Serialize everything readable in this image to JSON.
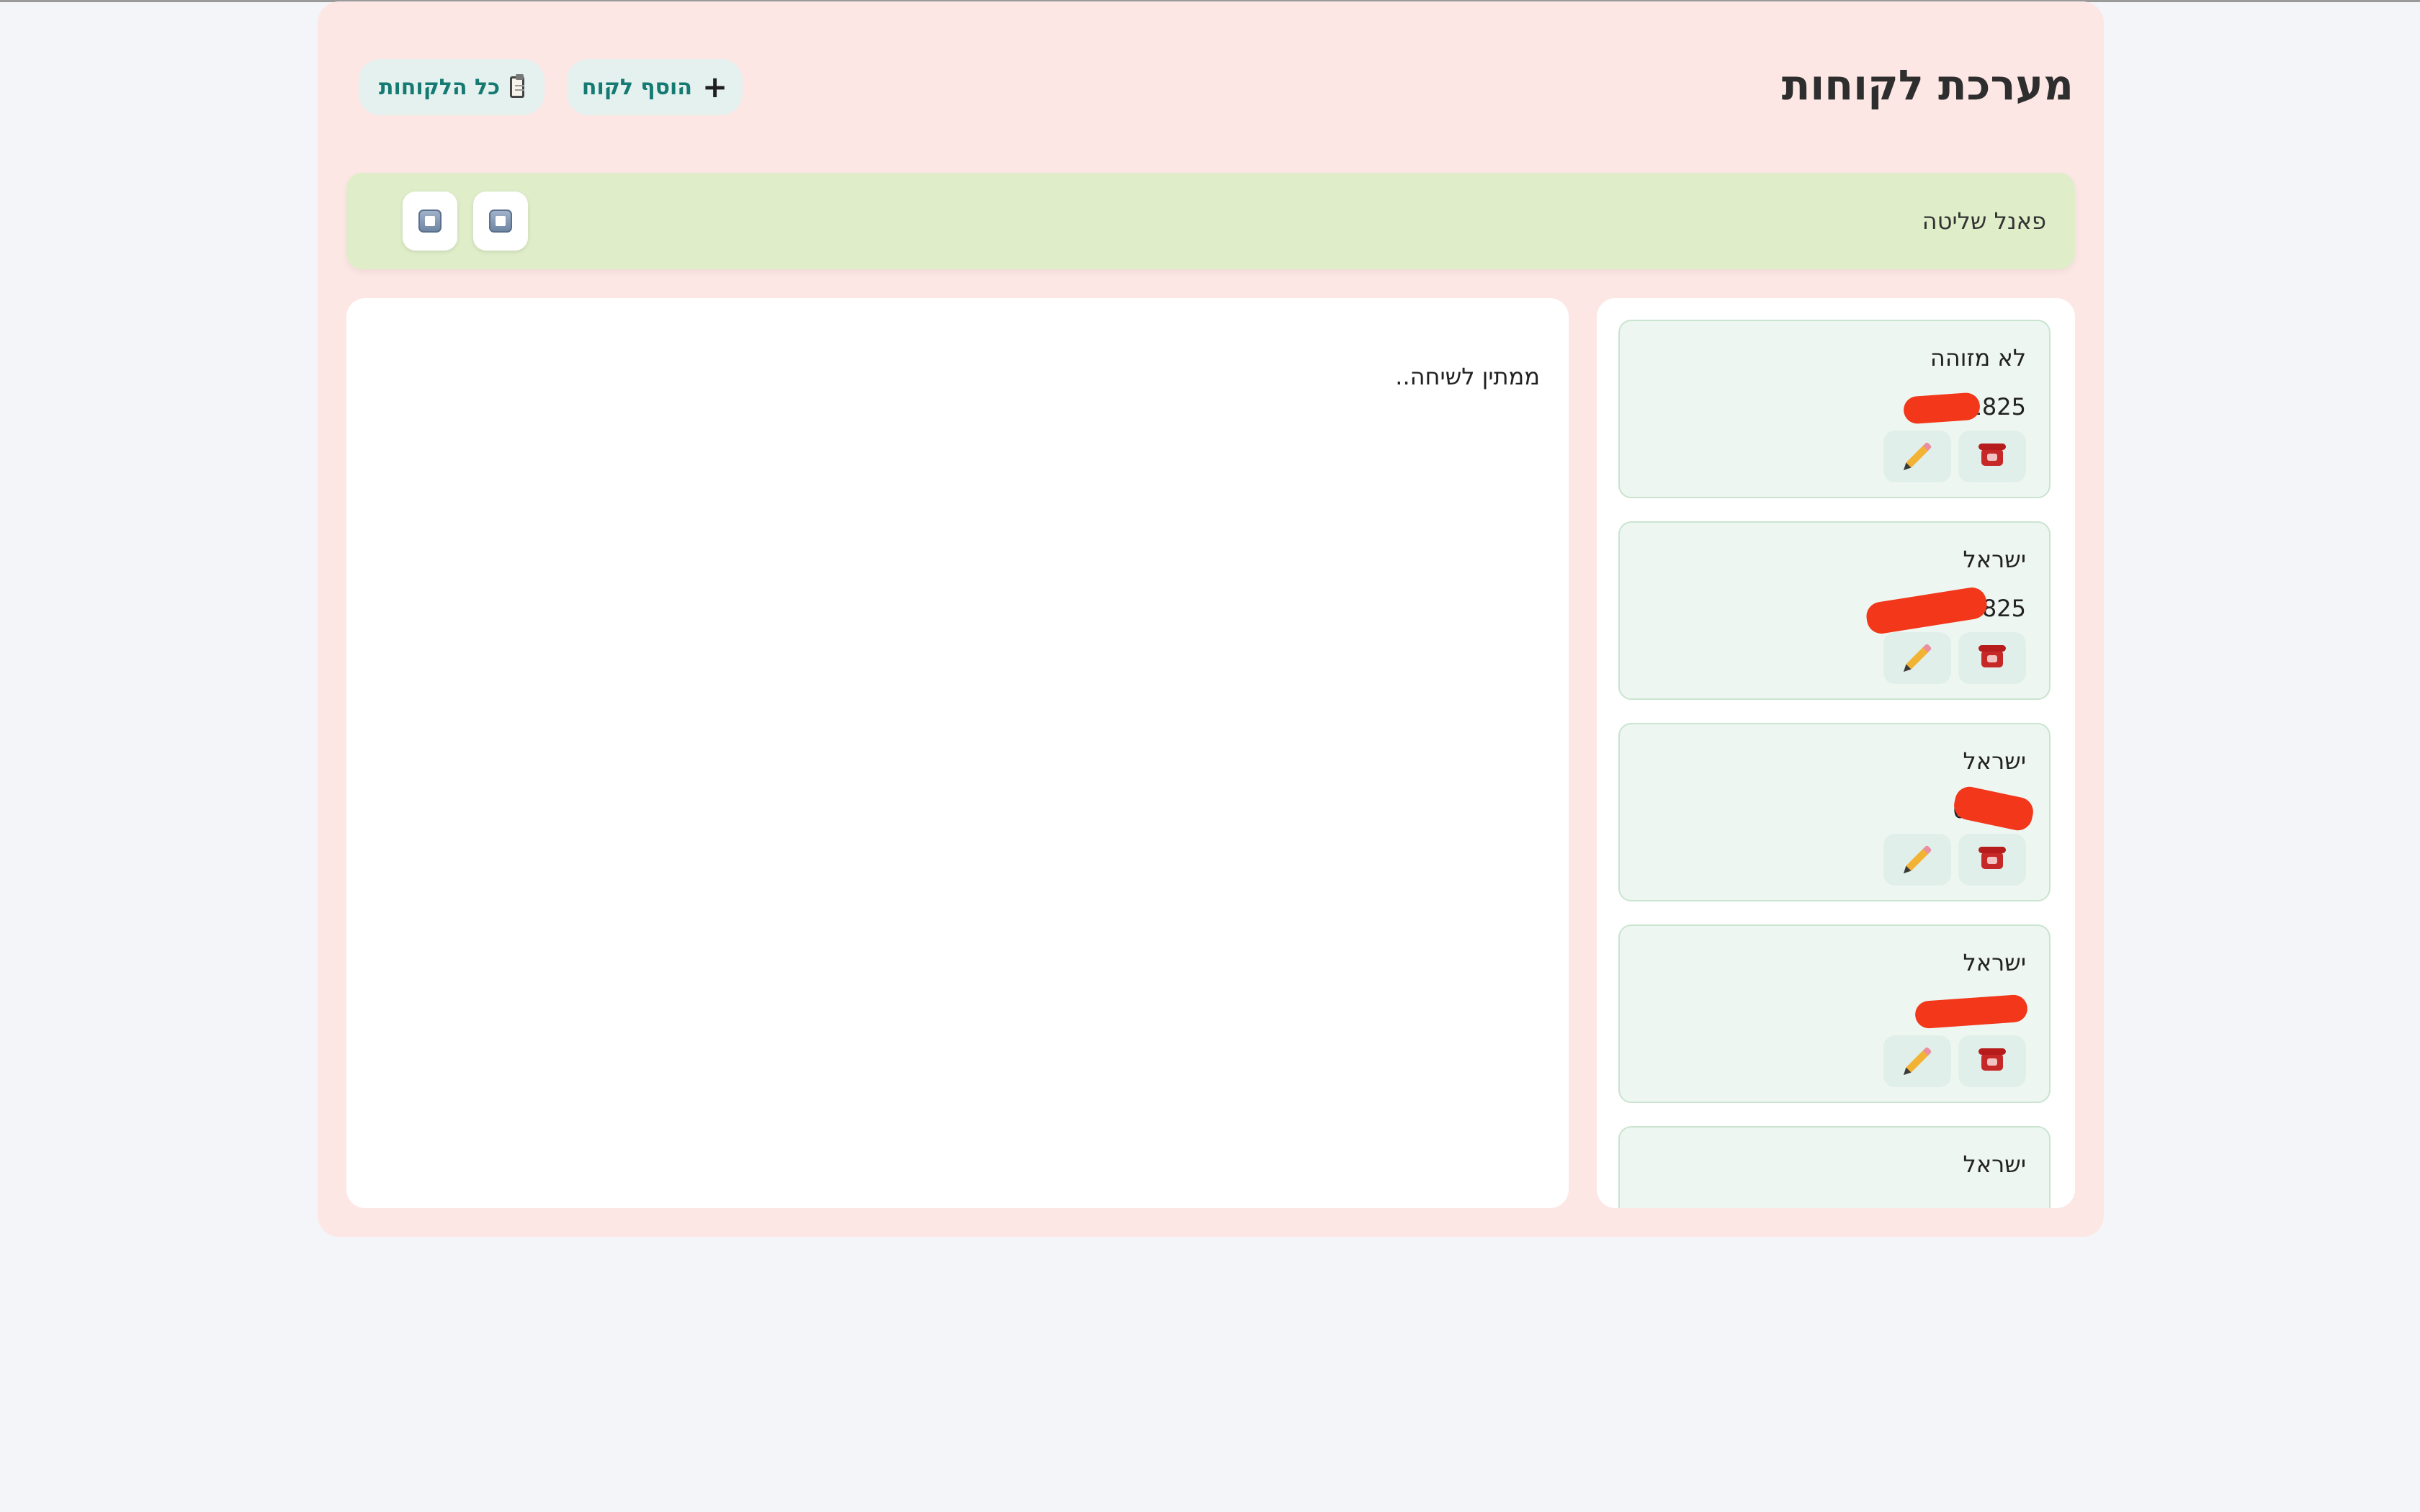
{
  "header": {
    "title": "מערכת לקוחות",
    "add_customer_label": "הוסף לקוח",
    "all_customers_label": "כל הלקוחות"
  },
  "control_panel": {
    "label": "פאנל שליטה"
  },
  "conversation": {
    "status_text": "ממתין לשיחה.."
  },
  "customers": [
    {
      "name": "לא מזוהה",
      "phone": "0541825"
    },
    {
      "name": "ישראל",
      "phone": "05041825"
    },
    {
      "name": "ישראל",
      "phone": "05331"
    },
    {
      "name": "ישראל",
      "phone": "05"
    },
    {
      "name": "ישראל",
      "phone": ""
    }
  ],
  "colors": {
    "page_background": "#f4f5f8",
    "app_background": "#fce7e5",
    "control_panel_background": "#dfedc9",
    "card_background": "#eef6f2",
    "button_text": "#157a72",
    "redaction": "#f2371a"
  }
}
